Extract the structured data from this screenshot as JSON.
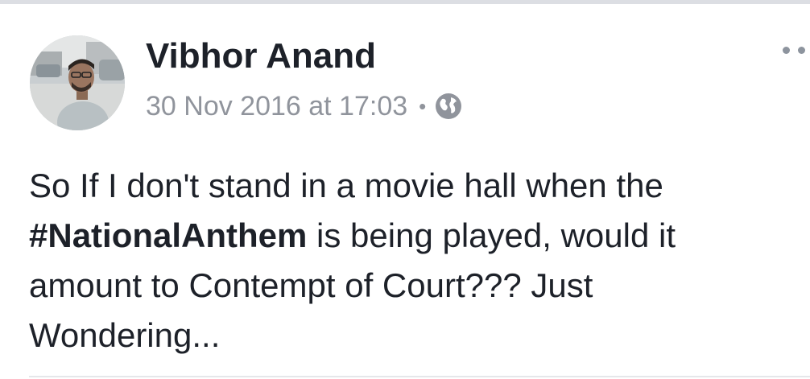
{
  "post": {
    "author": {
      "name": "Vibhor Anand",
      "avatar_icon": "profile-photo"
    },
    "timestamp": "30 Nov 2016 at 17:03",
    "separator": "•",
    "privacy_icon": "globe-icon",
    "more_icon": "more-options-icon",
    "text": {
      "part1": "So If I don't stand in a movie hall when the ",
      "hashtag": "#NationalAnthem",
      "part2": " is being played, would it amount to Contempt of Court??? Just Wondering..."
    }
  },
  "colors": {
    "name": "#1d2129",
    "meta": "#90949c",
    "body": "#1d2129"
  }
}
